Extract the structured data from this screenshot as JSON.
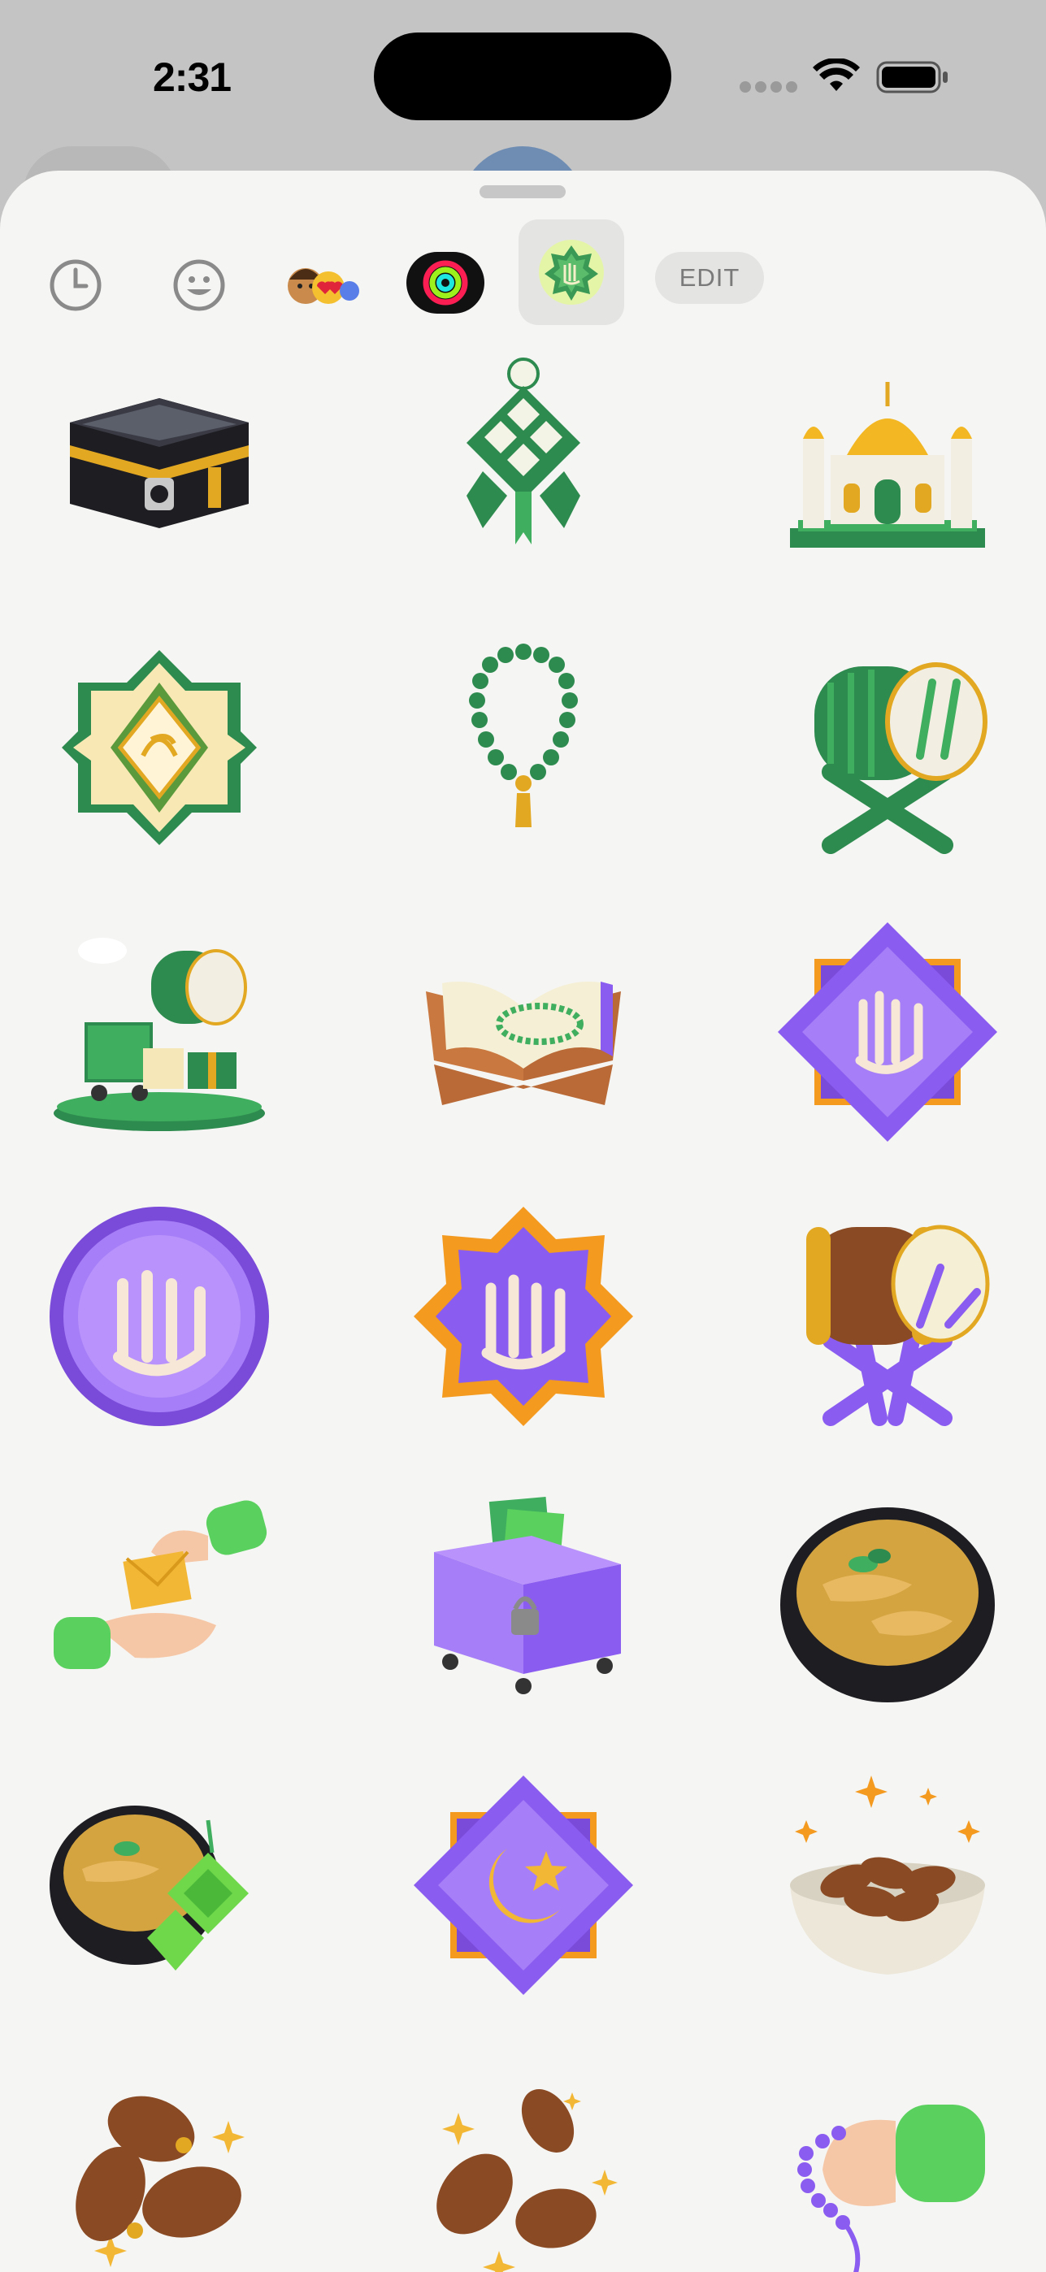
{
  "status_bar": {
    "time": "2:31",
    "icons": [
      "cellular-signal-icon",
      "wifi-icon",
      "battery-icon"
    ]
  },
  "tabs": {
    "items": [
      {
        "name": "recents",
        "icon": "clock-icon"
      },
      {
        "name": "emoji",
        "icon": "smiley-icon"
      },
      {
        "name": "memoji",
        "icon": "memoji-stickers-icon"
      },
      {
        "name": "activity",
        "icon": "activity-rings-icon"
      },
      {
        "name": "islamic-stickers",
        "icon": "allah-badge-icon",
        "selected": true
      }
    ],
    "edit_label": "EDIT"
  },
  "stickers": [
    {
      "name": "kaaba"
    },
    {
      "name": "ketupat"
    },
    {
      "name": "mosque"
    },
    {
      "name": "muhammad-calligraphy-frame"
    },
    {
      "name": "prayer-beads"
    },
    {
      "name": "green-bedug-drum"
    },
    {
      "name": "eid-shopping-scene"
    },
    {
      "name": "quran-on-stand"
    },
    {
      "name": "allah-diamond-purple"
    },
    {
      "name": "allah-circle-purple"
    },
    {
      "name": "allah-star-orange"
    },
    {
      "name": "purple-bedug-drum"
    },
    {
      "name": "giving-envelope-hands"
    },
    {
      "name": "donation-box"
    },
    {
      "name": "opor-ayam-bowl"
    },
    {
      "name": "opor-with-ketupat"
    },
    {
      "name": "crescent-star-diamond"
    },
    {
      "name": "dates-bowl"
    },
    {
      "name": "dates-pile"
    },
    {
      "name": "dates-scattered"
    },
    {
      "name": "hand-with-tasbih"
    }
  ],
  "colors": {
    "green": "#2e8b4f",
    "purple": "#8a5cf0",
    "gold": "#e3a822",
    "orange": "#f39a1f",
    "date_brown": "#8a4a24"
  }
}
